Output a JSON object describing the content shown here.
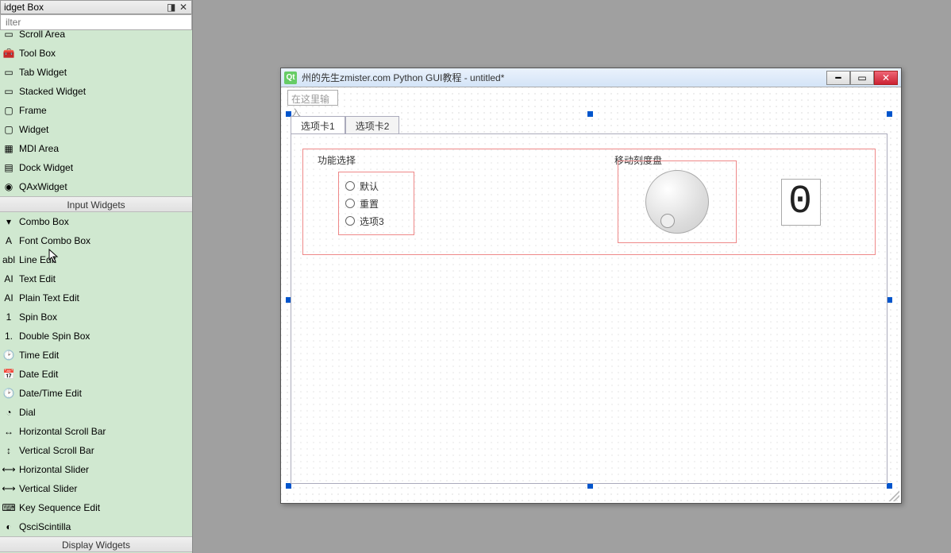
{
  "dock": {
    "title": "idget Box",
    "filter_ph": "ilter",
    "cat_input": "Input Widgets",
    "cat_display": "Display Widgets",
    "containers": [
      "Scroll Area",
      "Tool Box",
      "Tab Widget",
      "Stacked Widget",
      "Frame",
      "Widget",
      "MDI Area",
      "Dock Widget",
      "QAxWidget"
    ],
    "inputs": [
      "Combo Box",
      "Font Combo Box",
      "Line Edit",
      "Text Edit",
      "Plain Text Edit",
      "Spin Box",
      "Double Spin Box",
      "Time Edit",
      "Date Edit",
      "Date/Time Edit",
      "Dial",
      "Horizontal Scroll Bar",
      "Vertical Scroll Bar",
      "Horizontal Slider",
      "Vertical Slider",
      "Key Sequence Edit",
      "QsciScintilla"
    ]
  },
  "win": {
    "title": "州的先生zmister.com Python GUI教程 - untitled*",
    "lineedit_ph": "在这里输入",
    "tab1": "选项卡1",
    "tab2": "选项卡2",
    "grp1": "功能选择",
    "grp2": "移动刻度盘",
    "r1": "默认",
    "r2": "重置",
    "r3": "选项3",
    "lcd": "0"
  }
}
